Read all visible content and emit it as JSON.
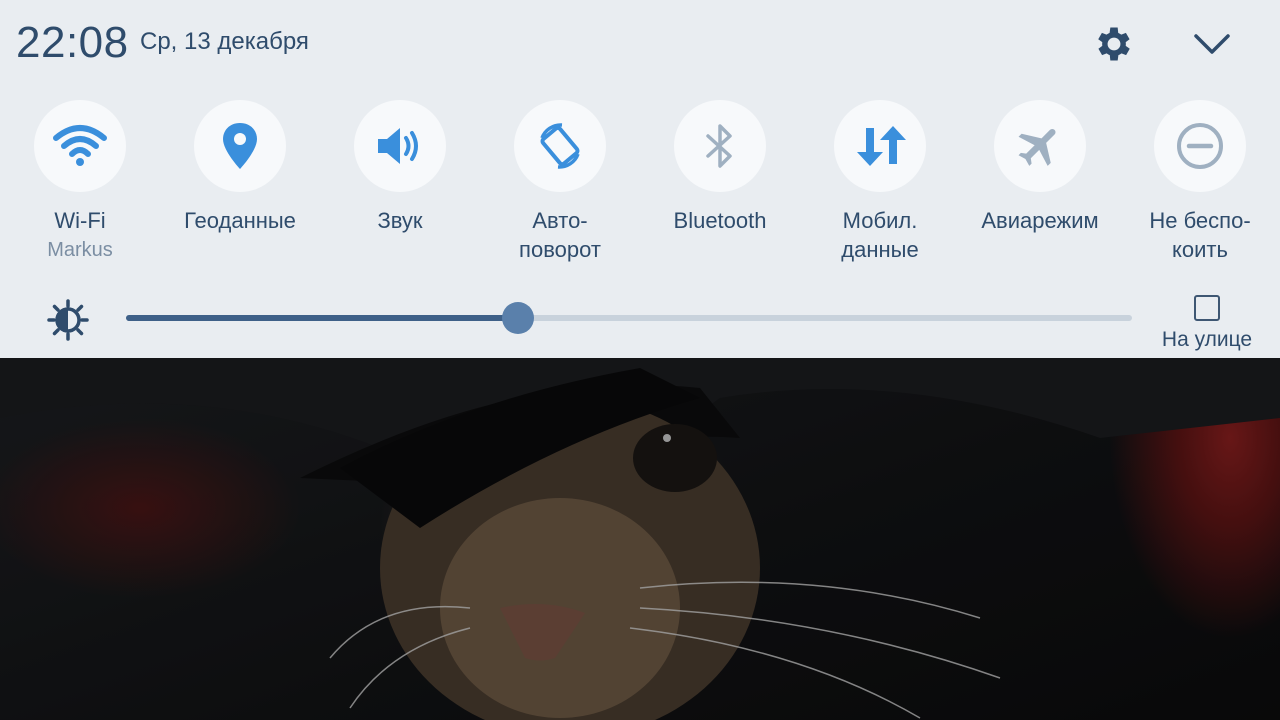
{
  "status": {
    "time": "22:08",
    "date": "Ср, 13 декабря",
    "settings_icon": "gear-icon",
    "collapse_icon": "chevron-down-icon"
  },
  "colors": {
    "panel_bg": "#e9edf1",
    "text_primary": "#2f4c6c",
    "icon_active": "#3a8fdc",
    "icon_inactive": "#9fb0c1"
  },
  "quick_settings": [
    {
      "label": "Wi-Fi",
      "sub": "Markus",
      "icon": "wifi-icon",
      "active": true
    },
    {
      "label": "Геоданные",
      "icon": "location-pin-icon",
      "active": true
    },
    {
      "label": "Звук",
      "icon": "speaker-icon",
      "active": true
    },
    {
      "label": "Авто-\nповорот",
      "icon": "auto-rotate-icon",
      "active": true
    },
    {
      "label": "Bluetooth",
      "icon": "bluetooth-icon",
      "active": false
    },
    {
      "label": "Мобил.\nданные",
      "icon": "mobile-data-icon",
      "active": true
    },
    {
      "label": "Авиарежим",
      "icon": "airplane-icon",
      "active": false
    },
    {
      "label": "Не беспо-\nкоить",
      "icon": "do-not-disturb-icon",
      "active": false
    }
  ],
  "brightness": {
    "icon": "brightness-icon",
    "level": 0.39,
    "outdoor_label": "На улице",
    "outdoor_checked": false
  },
  "wallpaper": {
    "description": "photo"
  }
}
